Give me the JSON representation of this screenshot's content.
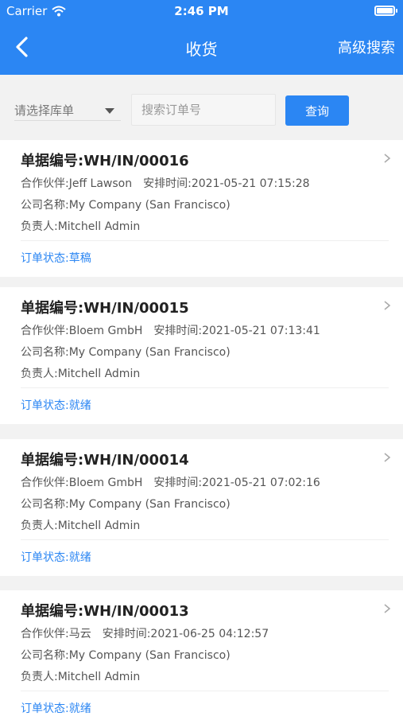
{
  "status_bar": {
    "carrier": "Carrier",
    "time": "2:46 PM"
  },
  "nav": {
    "title": "收货",
    "advanced_search": "高级搜索"
  },
  "search": {
    "warehouse_select_placeholder": "请选择库单",
    "order_placeholder": "搜索订单号",
    "query_label": "查询"
  },
  "orders": [
    {
      "number": "单据编号:WH/IN/00016",
      "partner": "合作伙伴:Jeff Lawson",
      "scheduled": "安排时间:2021-05-21 07:15:28",
      "company": "公司名称:My Company (San Francisco)",
      "responsible": "负责人:Mitchell Admin",
      "status": "订单状态:草稿"
    },
    {
      "number": "单据编号:WH/IN/00015",
      "partner": "合作伙伴:Bloem GmbH",
      "scheduled": "安排时间:2021-05-21 07:13:41",
      "company": "公司名称:My Company (San Francisco)",
      "responsible": "负责人:Mitchell Admin",
      "status": "订单状态:就绪"
    },
    {
      "number": "单据编号:WH/IN/00014",
      "partner": "合作伙伴:Bloem GmbH",
      "scheduled": "安排时间:2021-05-21 07:02:16",
      "company": "公司名称:My Company (San Francisco)",
      "responsible": "负责人:Mitchell Admin",
      "status": "订单状态:就绪"
    },
    {
      "number": "单据编号:WH/IN/00013",
      "partner": "合作伙伴:马云",
      "scheduled": "安排时间:2021-06-25 04:12:57",
      "company": "公司名称:My Company (San Francisco)",
      "responsible": "负责人:Mitchell Admin",
      "status": "订单状态:就绪"
    }
  ]
}
